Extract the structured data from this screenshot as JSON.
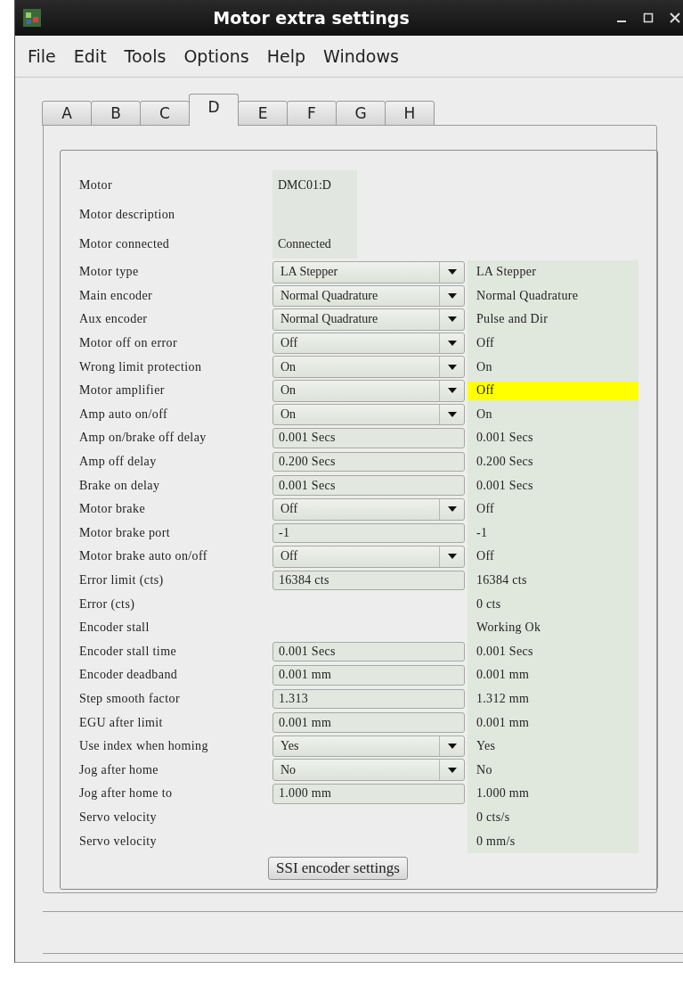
{
  "window": {
    "title": "Motor extra settings"
  },
  "menu": [
    "File",
    "Edit",
    "Tools",
    "Options",
    "Help",
    "Windows"
  ],
  "tabs": [
    {
      "label": "A",
      "selected": false
    },
    {
      "label": "B",
      "selected": false
    },
    {
      "label": "C",
      "selected": false
    },
    {
      "label": "D",
      "selected": true
    },
    {
      "label": "E",
      "selected": false
    },
    {
      "label": "F",
      "selected": false
    },
    {
      "label": "G",
      "selected": false
    },
    {
      "label": "H",
      "selected": false
    }
  ],
  "info": [
    {
      "label": "Motor",
      "value": "DMC01:D"
    },
    {
      "label": "Motor description"
    },
    {
      "label": "Motor connected",
      "value": "Connected"
    }
  ],
  "rows": [
    {
      "label": "Motor type",
      "kind": "combo",
      "value": "LA Stepper",
      "readback": "LA Stepper",
      "alert": false
    },
    {
      "label": "Main encoder",
      "kind": "combo",
      "value": "Normal Quadrature",
      "readback": "Normal Quadrature",
      "alert": false
    },
    {
      "label": "Aux encoder",
      "kind": "combo",
      "value": "Normal Quadrature",
      "readback": "Pulse and Dir",
      "alert": false
    },
    {
      "label": "Motor off on error",
      "kind": "combo",
      "value": "Off",
      "readback": "Off",
      "alert": false
    },
    {
      "label": "Wrong limit protection",
      "kind": "combo",
      "value": "On",
      "readback": "On",
      "alert": false
    },
    {
      "label": "Motor amplifier",
      "kind": "combo",
      "value": "On",
      "readback": "Off",
      "alert": true
    },
    {
      "label": "Amp auto on/off",
      "kind": "combo",
      "value": "On",
      "readback": "On",
      "alert": false
    },
    {
      "label": "Amp on/brake off delay",
      "kind": "entry",
      "value": "0.001 Secs",
      "readback": "0.001 Secs",
      "alert": false
    },
    {
      "label": "Amp off delay",
      "kind": "entry",
      "value": "0.200 Secs",
      "readback": "0.200 Secs",
      "alert": false
    },
    {
      "label": "Brake on delay",
      "kind": "entry",
      "value": "0.001 Secs",
      "readback": "0.001 Secs",
      "alert": false
    },
    {
      "label": "Motor brake",
      "kind": "combo",
      "value": "Off",
      "readback": "Off",
      "alert": false
    },
    {
      "label": "Motor brake port",
      "kind": "entry",
      "value": "-1",
      "readback": "-1",
      "alert": false
    },
    {
      "label": "Motor brake auto on/off",
      "kind": "combo",
      "value": "Off",
      "readback": "Off",
      "alert": false
    },
    {
      "label": "Error limit (cts)",
      "kind": "entry",
      "value": "16384 cts",
      "readback": "16384 cts",
      "alert": false
    },
    {
      "label": "Error (cts)",
      "kind": "none",
      "readback": "0 cts",
      "alert": false
    },
    {
      "label": "Encoder stall",
      "kind": "none",
      "readback": "Working Ok",
      "alert": false
    },
    {
      "label": "Encoder stall time",
      "kind": "entry",
      "value": "0.001 Secs",
      "readback": "0.001 Secs",
      "alert": false
    },
    {
      "label": "Encoder deadband",
      "kind": "entry",
      "value": "0.001 mm",
      "readback": "0.001 mm",
      "alert": false
    },
    {
      "label": "Step smooth factor",
      "kind": "entry",
      "value": "1.313",
      "readback": "1.312 mm",
      "alert": false
    },
    {
      "label": "EGU after limit",
      "kind": "entry",
      "value": "0.001 mm",
      "readback": "0.001 mm",
      "alert": false
    },
    {
      "label": "Use index when homing",
      "kind": "combo",
      "value": "Yes",
      "readback": "Yes",
      "alert": false
    },
    {
      "label": "Jog after home",
      "kind": "combo",
      "value": "No",
      "readback": "No",
      "alert": false
    },
    {
      "label": "Jog after home to",
      "kind": "entry",
      "value": "1.000 mm",
      "readback": "1.000 mm",
      "alert": false
    },
    {
      "label": "Servo velocity",
      "kind": "none",
      "readback": "0 cts/s",
      "alert": false
    },
    {
      "label": "Servo velocity",
      "kind": "none",
      "readback": "0 mm/s",
      "alert": false
    }
  ],
  "button": "SSI encoder settings"
}
